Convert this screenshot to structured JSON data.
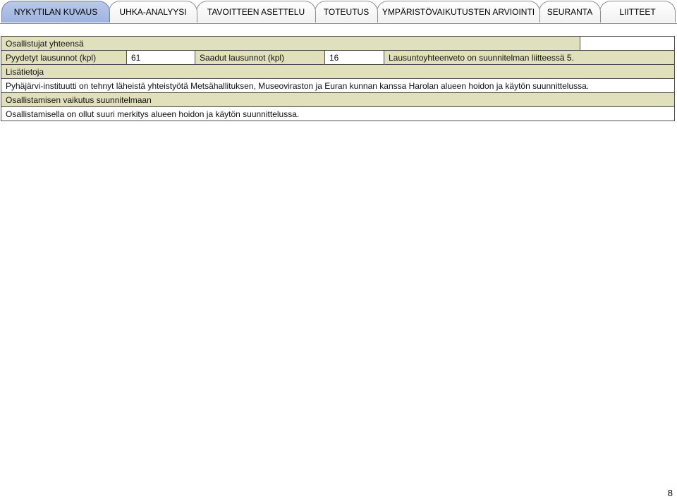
{
  "tabs": [
    {
      "label": "NYKYTILAN KUVAUS",
      "active": true
    },
    {
      "label": "UHKA-ANALYYSI",
      "active": false
    },
    {
      "label": "TAVOITTEEN ASETTELU",
      "active": false
    },
    {
      "label": "TOTEUTUS",
      "active": false
    },
    {
      "label": "YMPÄRISTÖVAIKUTUSTEN ARVIOINTI",
      "active": false
    },
    {
      "label": "SEURANTA",
      "active": false
    },
    {
      "label": "LIITTEET",
      "active": false
    }
  ],
  "participation": {
    "heading": "Osallistujat yhteensä",
    "requested_label": "Pyydetyt lausunnot (kpl)",
    "requested_value": "61",
    "received_label": "Saadut lausunnot (kpl)",
    "received_value": "16",
    "summary_note": "Lausuntoyhteenveto on suunnitelman liitteessä 5.",
    "additional_heading": "Lisätietoja",
    "additional_text": "Pyhäjärvi-instituutti on tehnyt läheistä yhteistyötä Metsähallituksen, Museoviraston ja Euran kunnan kanssa Harolan alueen hoidon ja käytön suunnittelussa.",
    "impact_heading": "Osallistamisen vaikutus suunnitelmaan",
    "impact_text": "Osallistamisella on ollut suuri merkitys alueen hoidon ja käytön suunnittelussa."
  },
  "colors": {
    "active_tab": "#b3c5e8",
    "row_highlight": "#e0e0bd",
    "border": "#4d4d4d"
  },
  "page_number": "8"
}
